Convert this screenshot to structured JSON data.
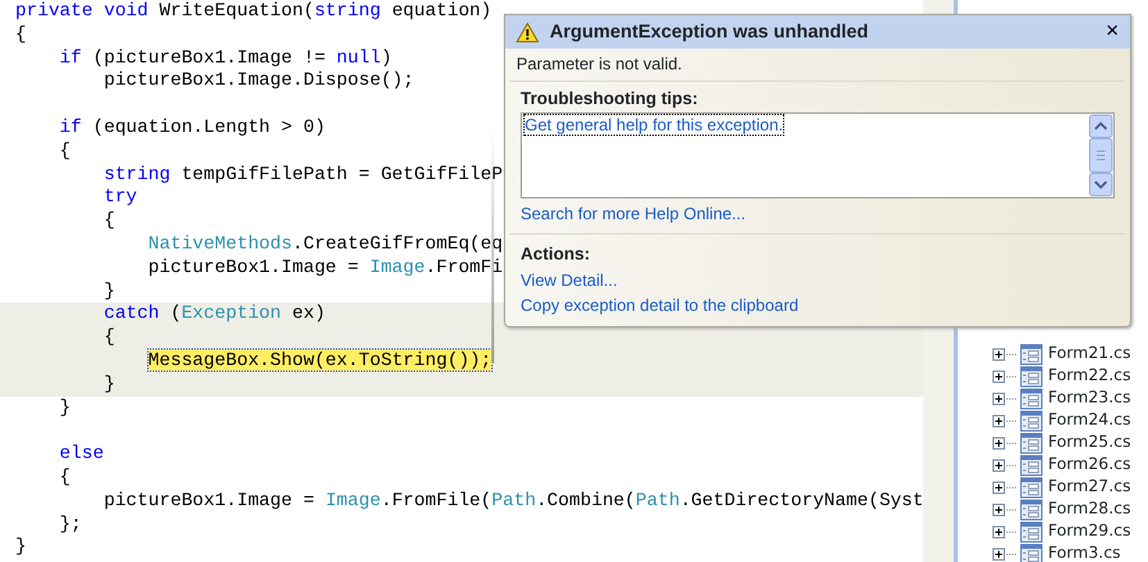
{
  "editor": {
    "lines": [
      {
        "tokens": [
          {
            "kind": "keyword",
            "text": "private void "
          },
          {
            "kind": "plain",
            "text": "WriteEquation("
          },
          {
            "kind": "keyword",
            "text": "string"
          },
          {
            "kind": "plain",
            "text": " equation)"
          }
        ]
      },
      {
        "tokens": [
          {
            "kind": "plain",
            "text": "{"
          }
        ]
      },
      {
        "tokens": [
          {
            "kind": "keyword",
            "text": "    if"
          },
          {
            "kind": "plain",
            "text": " (pictureBox1.Image != "
          },
          {
            "kind": "keyword",
            "text": "null"
          },
          {
            "kind": "plain",
            "text": ")"
          }
        ]
      },
      {
        "tokens": [
          {
            "kind": "plain",
            "text": "        pictureBox1.Image.Dispose();"
          }
        ]
      },
      {
        "kind": "blank"
      },
      {
        "tokens": [
          {
            "kind": "keyword",
            "text": "    if"
          },
          {
            "kind": "plain",
            "text": " (equation.Length > 0)"
          }
        ]
      },
      {
        "tokens": [
          {
            "kind": "plain",
            "text": "    {"
          }
        ]
      },
      {
        "tokens": [
          {
            "kind": "keyword",
            "text": "        string"
          },
          {
            "kind": "plain",
            "text": " tempGifFilePath = GetGifFileP"
          }
        ]
      },
      {
        "tokens": [
          {
            "kind": "keyword",
            "text": "        try"
          }
        ]
      },
      {
        "tokens": [
          {
            "kind": "plain",
            "text": "        {"
          }
        ]
      },
      {
        "tokens": [
          {
            "kind": "type",
            "text": "            NativeMethods"
          },
          {
            "kind": "plain",
            "text": ".CreateGifFromEq(eq"
          }
        ]
      },
      {
        "tokens": [
          {
            "kind": "plain",
            "text": "            pictureBox1.Image = "
          },
          {
            "kind": "type",
            "text": "Image"
          },
          {
            "kind": "plain",
            "text": ".FromFi"
          }
        ]
      },
      {
        "tokens": [
          {
            "kind": "plain",
            "text": "        }"
          }
        ]
      },
      {
        "highlighted": true,
        "tokens": [
          {
            "kind": "keyword",
            "text": "        catch"
          },
          {
            "kind": "plain",
            "text": " ("
          },
          {
            "kind": "type",
            "text": "Exception"
          },
          {
            "kind": "plain",
            "text": " ex)"
          }
        ]
      },
      {
        "highlighted": true,
        "tokens": [
          {
            "kind": "plain",
            "text": "        {"
          }
        ]
      },
      {
        "highlighted": true,
        "current": true,
        "tokens": [
          {
            "kind": "plain",
            "text": "            MessageBox.Show(ex.ToString());"
          }
        ]
      },
      {
        "highlighted": true,
        "tokens": [
          {
            "kind": "plain",
            "text": "        }"
          }
        ]
      },
      {
        "tokens": [
          {
            "kind": "plain",
            "text": "    }"
          }
        ]
      },
      {
        "kind": "blank"
      },
      {
        "tokens": [
          {
            "kind": "keyword",
            "text": "    else"
          }
        ]
      },
      {
        "tokens": [
          {
            "kind": "plain",
            "text": "    {"
          }
        ]
      },
      {
        "tokens": [
          {
            "kind": "plain",
            "text": "        pictureBox1.Image = "
          },
          {
            "kind": "type",
            "text": "Image"
          },
          {
            "kind": "plain",
            "text": ".FromFile("
          },
          {
            "kind": "type",
            "text": "Path"
          },
          {
            "kind": "plain",
            "text": ".Combine("
          },
          {
            "kind": "type",
            "text": "Path"
          },
          {
            "kind": "plain",
            "text": ".GetDirectoryName(Syst"
          }
        ]
      },
      {
        "tokens": [
          {
            "kind": "plain",
            "text": "    };"
          }
        ]
      },
      {
        "tokens": [
          {
            "kind": "plain",
            "text": "}"
          }
        ]
      }
    ]
  },
  "solution_tree": {
    "items": [
      {
        "label": "Form21.cs",
        "expanded": false
      },
      {
        "label": "Form22.cs",
        "expanded": false
      },
      {
        "label": "Form23.cs",
        "expanded": false
      },
      {
        "label": "Form24.cs",
        "expanded": false
      },
      {
        "label": "Form25.cs",
        "expanded": false
      },
      {
        "label": "Form26.cs",
        "expanded": false
      },
      {
        "label": "Form27.cs",
        "expanded": false
      },
      {
        "label": "Form28.cs",
        "expanded": false
      },
      {
        "label": "Form29.cs",
        "expanded": false
      },
      {
        "label": "Form3.cs",
        "expanded": false
      }
    ]
  },
  "exception_popup": {
    "title": "ArgumentException was unhandled",
    "close": "×",
    "message": "Parameter is not valid.",
    "tips_heading": "Troubleshooting tips:",
    "tips": [
      "Get general help for this exception."
    ],
    "help_link": "Search for more Help Online...",
    "actions_heading": "Actions:",
    "actions": [
      "View Detail...",
      "Copy exception detail to the clipboard"
    ]
  }
}
